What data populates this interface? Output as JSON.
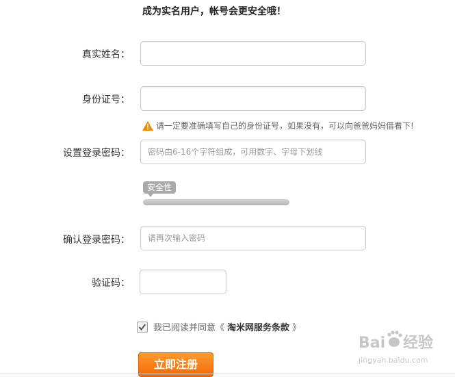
{
  "form": {
    "heading": "成为实名用户，帐号会更安全哦！",
    "real_name": {
      "label": "真实姓名：",
      "value": "",
      "placeholder": ""
    },
    "id_number": {
      "label": "身份证号：",
      "value": "",
      "placeholder": "",
      "hint": "请一定要准确填写自己的身份证号，如果没有，可以向爸爸妈妈借看下!"
    },
    "password": {
      "label": "设置登录密码：",
      "value": "",
      "placeholder": "密码由6-16个字符组成，可用数字、字母下划线",
      "strength_label": "安全性",
      "strength_level": 0
    },
    "confirm_password": {
      "label": "确认登录密码：",
      "value": "",
      "placeholder": "请再次输入密码"
    },
    "captcha": {
      "label": "验证码：",
      "value": "",
      "placeholder": ""
    },
    "agreement": {
      "checked": true,
      "prefix": "我已阅读并同意《",
      "link_text": "淘米网服务条款",
      "suffix": "》"
    },
    "submit_label": "立即注册"
  },
  "watermark": {
    "text": "Baidu经验",
    "subtext": "jingyan.baidu.com"
  },
  "colors": {
    "accent_orange": "#f26a08",
    "warning_orange": "#f08c00",
    "input_border": "#c8c8c8"
  }
}
